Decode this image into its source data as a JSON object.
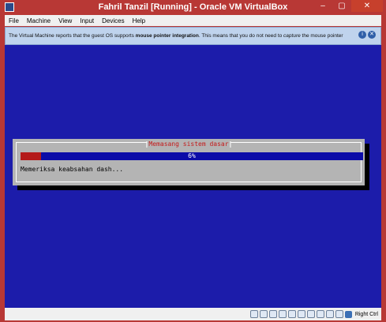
{
  "window": {
    "title": "Fahril Tanzil [Running] - Oracle VM VirtualBox",
    "controls": [
      "–",
      "▢",
      "✕"
    ]
  },
  "menu": [
    "File",
    "Machine",
    "View",
    "Input",
    "Devices",
    "Help"
  ],
  "notification": {
    "text_before": "The Virtual Machine reports that the guest OS supports ",
    "text_bold": "mouse pointer integration",
    "text_middle": ". This means that you do not need to ",
    "text_italic": "capture",
    "text_after": " the mouse pointer",
    "icons": [
      "i",
      "✕"
    ]
  },
  "installer": {
    "dialog_title": "Memasang sistem dasar",
    "progress_percent": 6,
    "progress_label": "6%",
    "status": "Memeriksa keabsahan dash..."
  },
  "statusbar": {
    "icons": [
      "hard-disk-icon",
      "optical-drive-icon",
      "audio-icon",
      "network-icon",
      "usb-icon",
      "shared-folder-icon",
      "display-icon",
      "video-capture-icon",
      "mouse-integration-icon",
      "cpu-icon",
      "keyboard-icon"
    ],
    "host_key": "Right Ctrl"
  }
}
